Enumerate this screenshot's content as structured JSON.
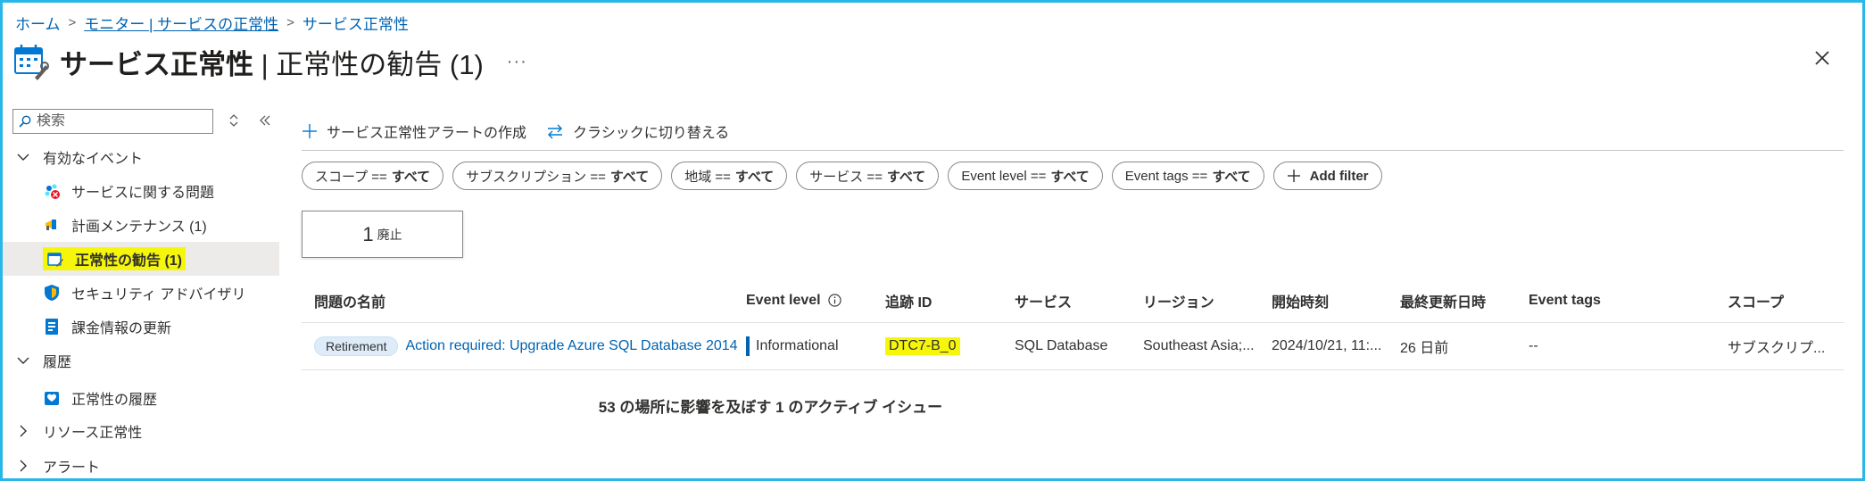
{
  "breadcrumb": {
    "home": "ホーム",
    "monitor": "モニター | サービスの正常性",
    "current": "サービス正常性"
  },
  "page": {
    "title_bold": "サービス正常性",
    "title_rest": " | 正常性の勧告 (1)",
    "more": "···"
  },
  "sidebar": {
    "search_placeholder": "検索",
    "groups": [
      {
        "label": "有効なイベント",
        "items": [
          {
            "label": "サービスに関する問題",
            "icon": "service-issue-icon"
          },
          {
            "label": "計画メンテナンス (1)",
            "icon": "maintenance-megaphone-icon"
          },
          {
            "label": "正常性の勧告 (1)",
            "icon": "health-advisory-icon",
            "selected": true
          },
          {
            "label": "セキュリティ アドバイザリ",
            "icon": "security-shield-icon"
          },
          {
            "label": "課金情報の更新",
            "icon": "billing-icon"
          }
        ]
      },
      {
        "label": "履歴",
        "items": [
          {
            "label": "正常性の履歴",
            "icon": "health-history-icon"
          }
        ]
      }
    ],
    "collapsed_groups": [
      "リソース正常性",
      "アラート"
    ]
  },
  "toolbar": {
    "create_alert": "サービス正常性アラートの作成",
    "switch_classic": "クラシックに切り替える"
  },
  "filters": [
    {
      "key": "スコープ ==",
      "value": "すべて"
    },
    {
      "key": "サブスクリプション ==",
      "value": "すべて"
    },
    {
      "key": "地域 ==",
      "value": "すべて"
    },
    {
      "key": "サービス ==",
      "value": "すべて"
    },
    {
      "key": "Event level ==",
      "value": "すべて"
    },
    {
      "key": "Event tags ==",
      "value": "すべて"
    }
  ],
  "add_filter": "Add filter",
  "stat": {
    "count": "1",
    "label": "廃止"
  },
  "table": {
    "columns": [
      "問題の名前",
      "Event level",
      "追跡 ID",
      "サービス",
      "リージョン",
      "開始時刻",
      "最終更新日時",
      "Event tags",
      "スコープ"
    ],
    "rows": [
      {
        "badge": "Retirement",
        "name": "Action required: Upgrade Azure SQL Database 2014-",
        "level": "Informational",
        "tracking_id": "DTC7-B_0",
        "service": "SQL Database",
        "region": "Southeast Asia;...",
        "start": "2024/10/21, 11:...",
        "updated": "26 日前",
        "tags": "--",
        "scope": "サブスクリプ..."
      }
    ]
  },
  "summary": "53 の場所に影響を及ぼす 1 のアクティブ イシュー",
  "colors": {
    "accent": "#0063b1",
    "highlight": "#f6f60a",
    "frame": "#29b6e8"
  }
}
